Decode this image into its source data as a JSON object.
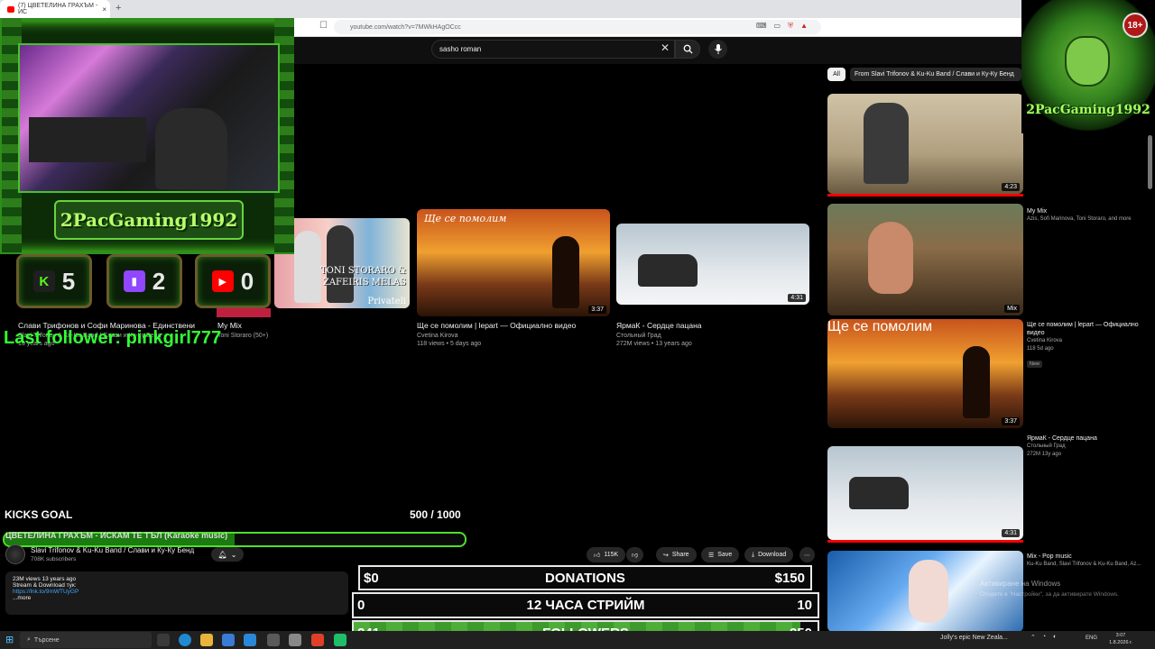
{
  "browser": {
    "tab_title": "(7) ЦВЕТЕЛИНА ГРАХЪМ - ИС",
    "tab_close": "×",
    "new_tab": "+",
    "url": "youtube.com/watch?v=7MWkHAgOCcc"
  },
  "search": {
    "query": "sasho roman",
    "clear": "✕",
    "button_icon": "search-icon",
    "mic_icon": "mic-icon"
  },
  "overlay": {
    "streamer_name": "2PacGaming1992",
    "counters": [
      {
        "platform": "Kick",
        "icon_letter": "K",
        "value": "5"
      },
      {
        "platform": "Twitch",
        "icon_letter": "▮",
        "value": "2"
      },
      {
        "platform": "YouTube",
        "icon_letter": "▶",
        "value": "0"
      }
    ],
    "last_follower": "Last follower: pinkgirl777",
    "logo_text": "2PacGaming1992",
    "age_badge": "18+",
    "colors": {
      "accent": "#4ee02c",
      "frame": "#2e8f1c"
    }
  },
  "grid": {
    "videos": [
      {
        "title": "Слави Трифонов и Софи Маринова - Единствени",
        "meta1": "Slavi Trifonov & Ku-Ku Band / Слави и Ку-Ку Бенд",
        "meta2": "13 years ago"
      },
      {
        "title": "My Mix",
        "meta1": "Toni Storaro (50+)",
        "meta2": "",
        "cover_text": "TONI STORARO & ZAFEIRIS MELAS",
        "cover_sub": "Privateli"
      },
      {
        "title": "Ще се помолим | lepart — Официално видео",
        "meta1": "Cvetina Kirova",
        "meta2": "118 views • 5 days ago",
        "duration": "3:37",
        "cover_title": "Ще се помолим"
      },
      {
        "title": "ЯрмаК - Сердце пацана",
        "meta1": "Стольный Град",
        "meta2": "272M views • 13 years ago",
        "duration": "4:31"
      }
    ]
  },
  "sidebar": {
    "chips": [
      "All",
      "From Slavi Trifonov & Ku-Ku Band / Слави и Ку-Ку Бенд"
    ],
    "items": [
      {
        "duration": "4:23"
      },
      {
        "title": "My Mix",
        "meta": "Azis, Sofi Marinova, Toni Storaro, and more",
        "badge": "Mix"
      },
      {
        "title": "Ще се помолим | lepart — Официално видео",
        "channel": "Cvetina Kirova",
        "meta": "118  5d ago",
        "new_badge": "New",
        "duration": "3:37",
        "cover_title": "Ще се помолим"
      },
      {
        "title": "ЯрмаК - Сердце пацана",
        "channel": "Стольный Град",
        "meta": "272M  13y ago",
        "duration": "4:31"
      },
      {
        "title": "Mix - Pop music",
        "meta": "Ku-Ku Band, Slavi Trifonov & Ku-Ku Band, Az..."
      }
    ]
  },
  "goal": {
    "label": "KICKS GOAL",
    "current": 500,
    "target": 1000,
    "display": "500 / 1000",
    "under_title": "ЦВЕТЕЛИНА ГРАХЪМ - ИСКАМ ТЕ ТЪЛ (Karaoke music)"
  },
  "video": {
    "channel": "Slavi Trifonov & Ku-Ku Band / Слави и Ку-Ку Бенд",
    "subscribers": "708K subscribers",
    "likes": "115K",
    "share": "Share",
    "save": "Save",
    "download": "Download",
    "more": "⋯",
    "desc_meta": "23M views  13 years ago",
    "desc_line": "Stream & Download тук:",
    "desc_link": "https://lnk.to/9mWTUyGP",
    "desc_more": "...more"
  },
  "panels": {
    "donations": {
      "left": "$0",
      "label": "DONATIONS",
      "right": "$150"
    },
    "stream": {
      "left": "0",
      "label": "12 ЧАСА СТРИЙМ",
      "right": "10"
    },
    "followers": {
      "left": "241",
      "label": "FOLLOWERS",
      "right": "250",
      "current": 241,
      "target": 250
    }
  },
  "windows": {
    "activate_title": "Активиране на Windows",
    "activate_sub": "Отидете в \"Настройки\", за да активирате Windows.",
    "search_placeholder": "Търсене",
    "notification": "Jolly's epic New Zeala...",
    "lang": "ENG",
    "time": "3:07",
    "date": "1.8.2026 г."
  }
}
